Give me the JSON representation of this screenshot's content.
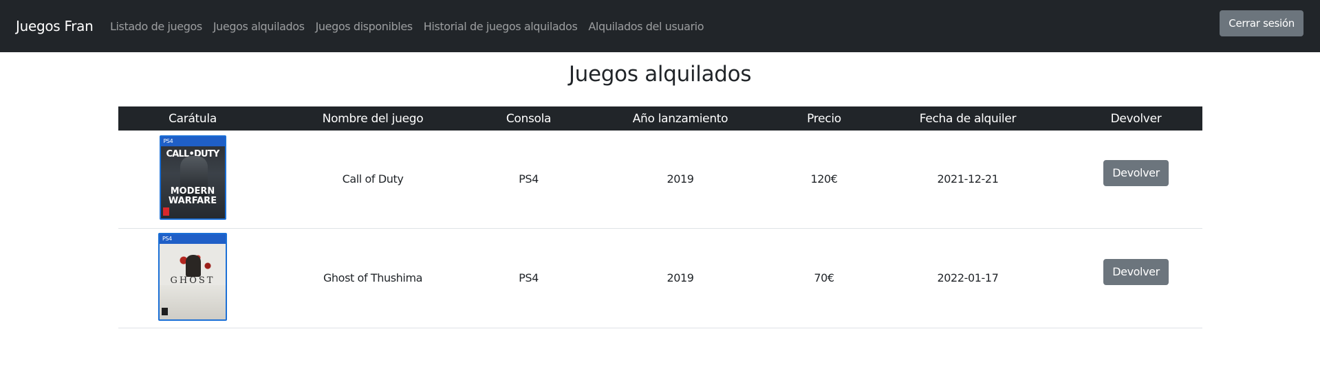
{
  "navbar": {
    "brand": "Juegos Fran",
    "links": [
      "Listado de juegos",
      "Juegos alquilados",
      "Juegos disponibles",
      "Historial de juegos alquilados",
      "Alquilados del usuario"
    ],
    "logout_label": "Cerrar sesión"
  },
  "page": {
    "title": "Juegos alquilados"
  },
  "table": {
    "headers": [
      "Carátula",
      "Nombre del juego",
      "Consola",
      "Año lanzamiento",
      "Precio",
      "Fecha de alquiler",
      "Devolver"
    ],
    "rows": [
      {
        "cover": {
          "platform": "PS4",
          "title_top": "CALL•DUTY",
          "title_line1": "MODERN",
          "title_line2": "WARFARE",
          "icon": "call-of-duty-cover-icon"
        },
        "name": "Call of Duty",
        "console": "PS4",
        "year": "2019",
        "price": "120€",
        "rent_date": "2021-12-21",
        "return_label": "Devolver"
      },
      {
        "cover": {
          "platform": "PS4",
          "title": "GHOST",
          "icon": "ghost-of-tsushima-cover-icon"
        },
        "name": "Ghost of Thushima",
        "console": "PS4",
        "year": "2019",
        "price": "70€",
        "rent_date": "2022-01-17",
        "return_label": "Devolver"
      }
    ]
  },
  "colors": {
    "navbar_bg": "#212529",
    "button_secondary": "#6c757d",
    "table_header_bg": "#212529",
    "row_border": "#dee2e6"
  }
}
